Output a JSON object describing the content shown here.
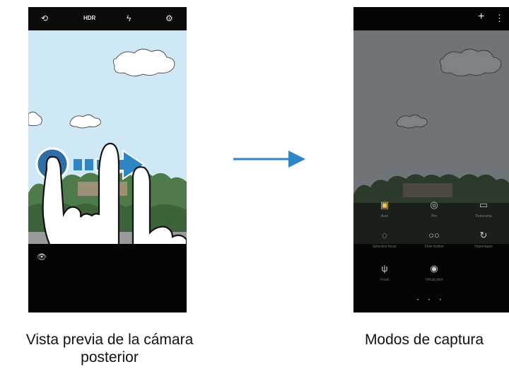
{
  "left_preview": {
    "top_icons": [
      {
        "name": "switch-camera-icon",
        "glyph": "⟲"
      },
      {
        "name": "hdr-label",
        "text": "HDR"
      },
      {
        "name": "flash-off-icon",
        "glyph": "ϟ"
      },
      {
        "name": "settings-icon",
        "glyph": "⚙"
      }
    ],
    "caption_line1": "Vista previa de la cámara",
    "caption_line2": "posterior"
  },
  "right_modes": {
    "top_icons": [
      {
        "name": "add-icon",
        "glyph": "+"
      },
      {
        "name": "more-icon",
        "glyph": "⋮"
      }
    ],
    "modes": [
      {
        "name": "mode-auto",
        "glyph": "📷",
        "label": "Auto",
        "active": true
      },
      {
        "name": "mode-pro",
        "glyph": "◎",
        "label": "Pro"
      },
      {
        "name": "mode-panorama",
        "glyph": "▭",
        "label": "Panorama"
      },
      {
        "name": "mode-selective-focus",
        "glyph": "◌",
        "label": "Selective focus"
      },
      {
        "name": "mode-slow-motion",
        "glyph": "○○",
        "label": "Slow motion"
      },
      {
        "name": "mode-hyperlapse",
        "glyph": "↻",
        "label": "Hyperlapse"
      },
      {
        "name": "mode-food",
        "glyph": "🍴",
        "label": "Food"
      },
      {
        "name": "mode-virtual-shot",
        "glyph": "◉",
        "label": "Virtual shot"
      }
    ],
    "page_dots": "• • •",
    "caption": "Modos de captura"
  },
  "colors": {
    "sky": "#cfe8f5",
    "dim_sky": "#6e7478",
    "arrow": "#2f86c4",
    "accent_mode": "#e9c35a"
  }
}
